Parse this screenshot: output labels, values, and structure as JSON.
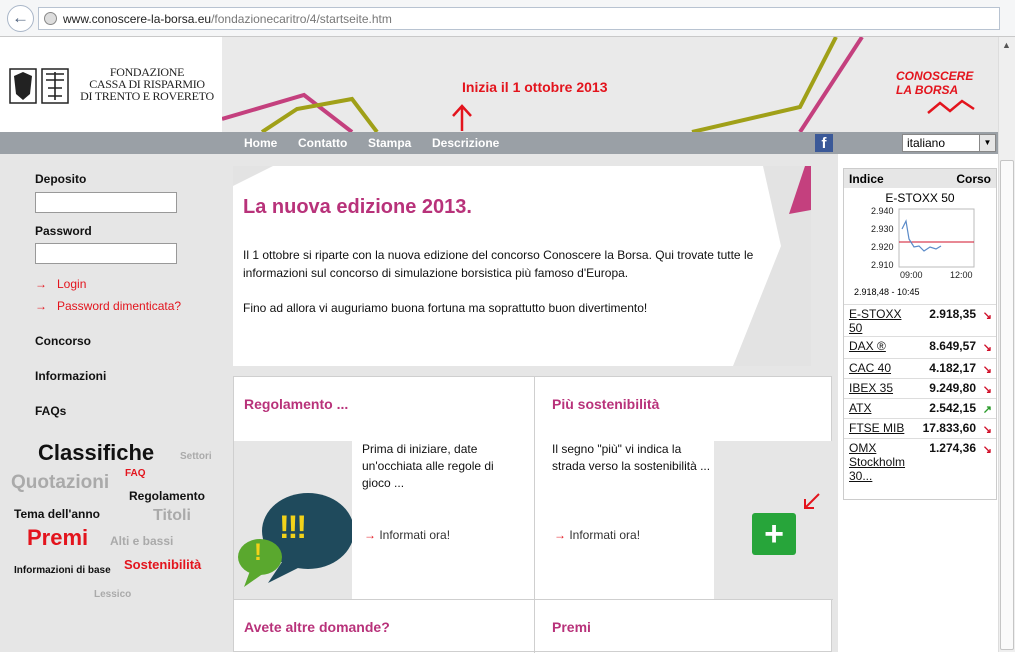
{
  "browser": {
    "url_domain": "www.conoscere-la-borsa.eu",
    "url_path": "/fondazionecaritro/4/startseite.htm"
  },
  "header": {
    "org_lines": [
      "FONDAZIONE",
      "CASSA DI RISPARMIO",
      "DI TRENTO E ROVERETO"
    ],
    "announcement": "Inizia il 1 ottobre 2013",
    "brand_line1": "CONOSCERE",
    "brand_line2": "LA BORSA"
  },
  "nav": {
    "items": [
      "Home",
      "Contatto",
      "Stampa",
      "Descrizione"
    ],
    "facebook": "f",
    "language": "italiano"
  },
  "sidebar": {
    "deposit_label": "Deposito",
    "password_label": "Password",
    "login_link": "Login",
    "forgot_link": "Password dimenticata?",
    "menu": [
      "Concorso",
      "Informazioni",
      "FAQs"
    ],
    "tags": [
      "Classifiche",
      "Settori",
      "Quotazioni",
      "FAQ",
      "Regolamento",
      "Tema dell'anno",
      "Titoli",
      "Premi",
      "Alti e bassi",
      "Informazioni di base",
      "Sostenibilità",
      "Lessico"
    ]
  },
  "main": {
    "title": "La nuova edizione 2013.",
    "para1": "Il 1 ottobre si riparte con la nuova edizione del concorso Conoscere la Borsa. Qui trovate tutte le informazioni sul concorso di simulazione borsistica più famoso d'Europa.",
    "para2": "Fino ad allora vi auguriamo buona fortuna ma soprattutto buon divertimento!",
    "cells": [
      {
        "title": "Regolamento ...",
        "text": "Prima di iniziare, date un'occhiata alle regole di gioco ...",
        "link": "Informati ora!",
        "icon_text": "!!!",
        "icon_text2": "!"
      },
      {
        "title": "Più sostenibilità",
        "text": "Il segno \"più\" vi indica la strada verso la sostenibilità ...",
        "link": "Informati ora!",
        "icon_text": "+"
      },
      {
        "title": "Avete altre domande?"
      },
      {
        "title": "Premi"
      }
    ]
  },
  "market": {
    "col_index": "Indice",
    "col_price": "Corso",
    "chart_title": "E-STOXX 50",
    "chart_yticks": [
      "2.940",
      "2.930",
      "2.920",
      "2.910"
    ],
    "chart_xticks": [
      "09:00",
      "12:00"
    ],
    "chart_caption": "2.918,48 - 10:45",
    "rows": [
      {
        "name": "E-STOXX 50",
        "value": "2.918,35",
        "dir": "down"
      },
      {
        "name": "DAX ®",
        "value": "8.649,57",
        "dir": "down"
      },
      {
        "name": "CAC 40",
        "value": "4.182,17",
        "dir": "down"
      },
      {
        "name": "IBEX 35",
        "value": "9.249,80",
        "dir": "down"
      },
      {
        "name": "ATX",
        "value": "2.542,15",
        "dir": "up"
      },
      {
        "name": "FTSE MIB",
        "value": "17.833,60",
        "dir": "down"
      },
      {
        "name": "OMX Stockholm 30...",
        "value": "1.274,36",
        "dir": "down"
      }
    ],
    "down_color": "#d0102a",
    "up_color": "#2a9a2a"
  }
}
